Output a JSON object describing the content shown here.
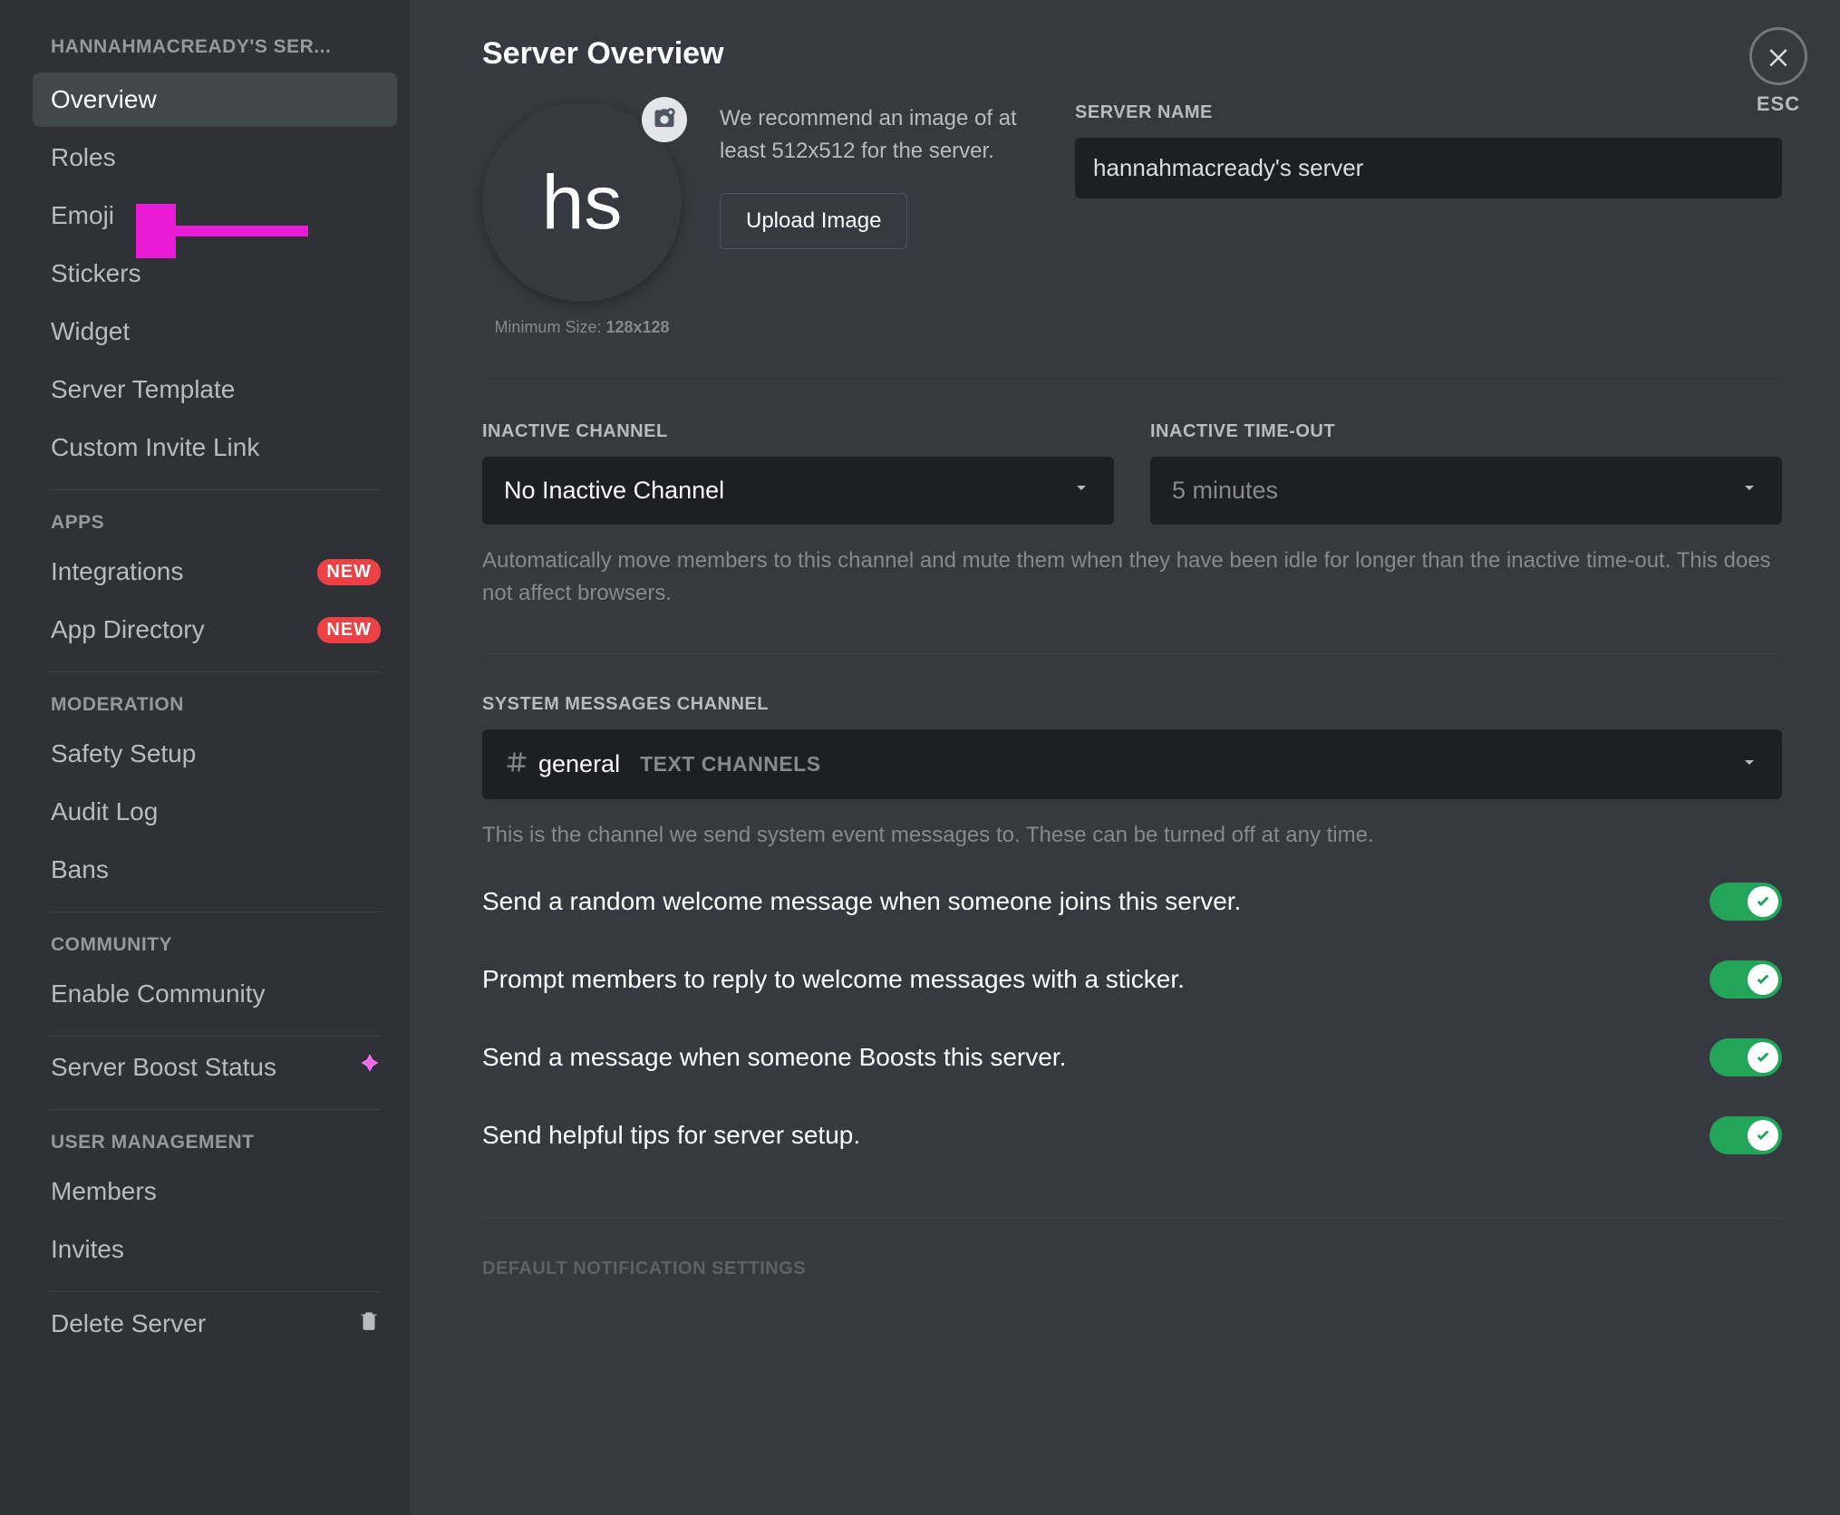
{
  "sidebar": {
    "server_name_header": "HANNAHMACREADY'S SER...",
    "items": [
      {
        "label": "Overview",
        "active": true
      },
      {
        "label": "Roles"
      },
      {
        "label": "Emoji"
      },
      {
        "label": "Stickers"
      },
      {
        "label": "Widget"
      },
      {
        "label": "Server Template"
      },
      {
        "label": "Custom Invite Link"
      }
    ],
    "apps_header": "APPS",
    "apps_items": [
      {
        "label": "Integrations",
        "badge": "NEW"
      },
      {
        "label": "App Directory",
        "badge": "NEW"
      }
    ],
    "moderation_header": "MODERATION",
    "moderation_items": [
      {
        "label": "Safety Setup"
      },
      {
        "label": "Audit Log"
      },
      {
        "label": "Bans"
      }
    ],
    "community_header": "COMMUNITY",
    "community_items": [
      {
        "label": "Enable Community"
      }
    ],
    "boost_item": {
      "label": "Server Boost Status"
    },
    "user_mgmt_header": "USER MANAGEMENT",
    "user_mgmt_items": [
      {
        "label": "Members"
      },
      {
        "label": "Invites"
      }
    ],
    "delete_item": {
      "label": "Delete Server"
    }
  },
  "page": {
    "title": "Server Overview",
    "close_label": "ESC"
  },
  "avatar": {
    "initials": "hs",
    "min_size_prefix": "Minimum Size: ",
    "min_size_value": "128x128",
    "recommend_text": "We recommend an image of at least 512x512 for the server.",
    "upload_btn": "Upload Image"
  },
  "server_name": {
    "label": "SERVER NAME",
    "value": "hannahmacready's server"
  },
  "inactive": {
    "channel_label": "INACTIVE CHANNEL",
    "channel_value": "No Inactive Channel",
    "timeout_label": "INACTIVE TIME-OUT",
    "timeout_value": "5 minutes",
    "help": "Automatically move members to this channel and mute them when they have been idle for longer than the inactive time-out. This does not affect browsers."
  },
  "system_messages": {
    "label": "SYSTEM MESSAGES CHANNEL",
    "channel_name": "general",
    "channel_category": "TEXT CHANNELS",
    "help": "This is the channel we send system event messages to. These can be turned off at any time.",
    "toggles": [
      {
        "label": "Send a random welcome message when someone joins this server.",
        "on": true
      },
      {
        "label": "Prompt members to reply to welcome messages with a sticker.",
        "on": true
      },
      {
        "label": "Send a message when someone Boosts this server.",
        "on": true
      },
      {
        "label": "Send helpful tips for server setup.",
        "on": true
      }
    ]
  },
  "bottom_header": "DEFAULT NOTIFICATION SETTINGS"
}
